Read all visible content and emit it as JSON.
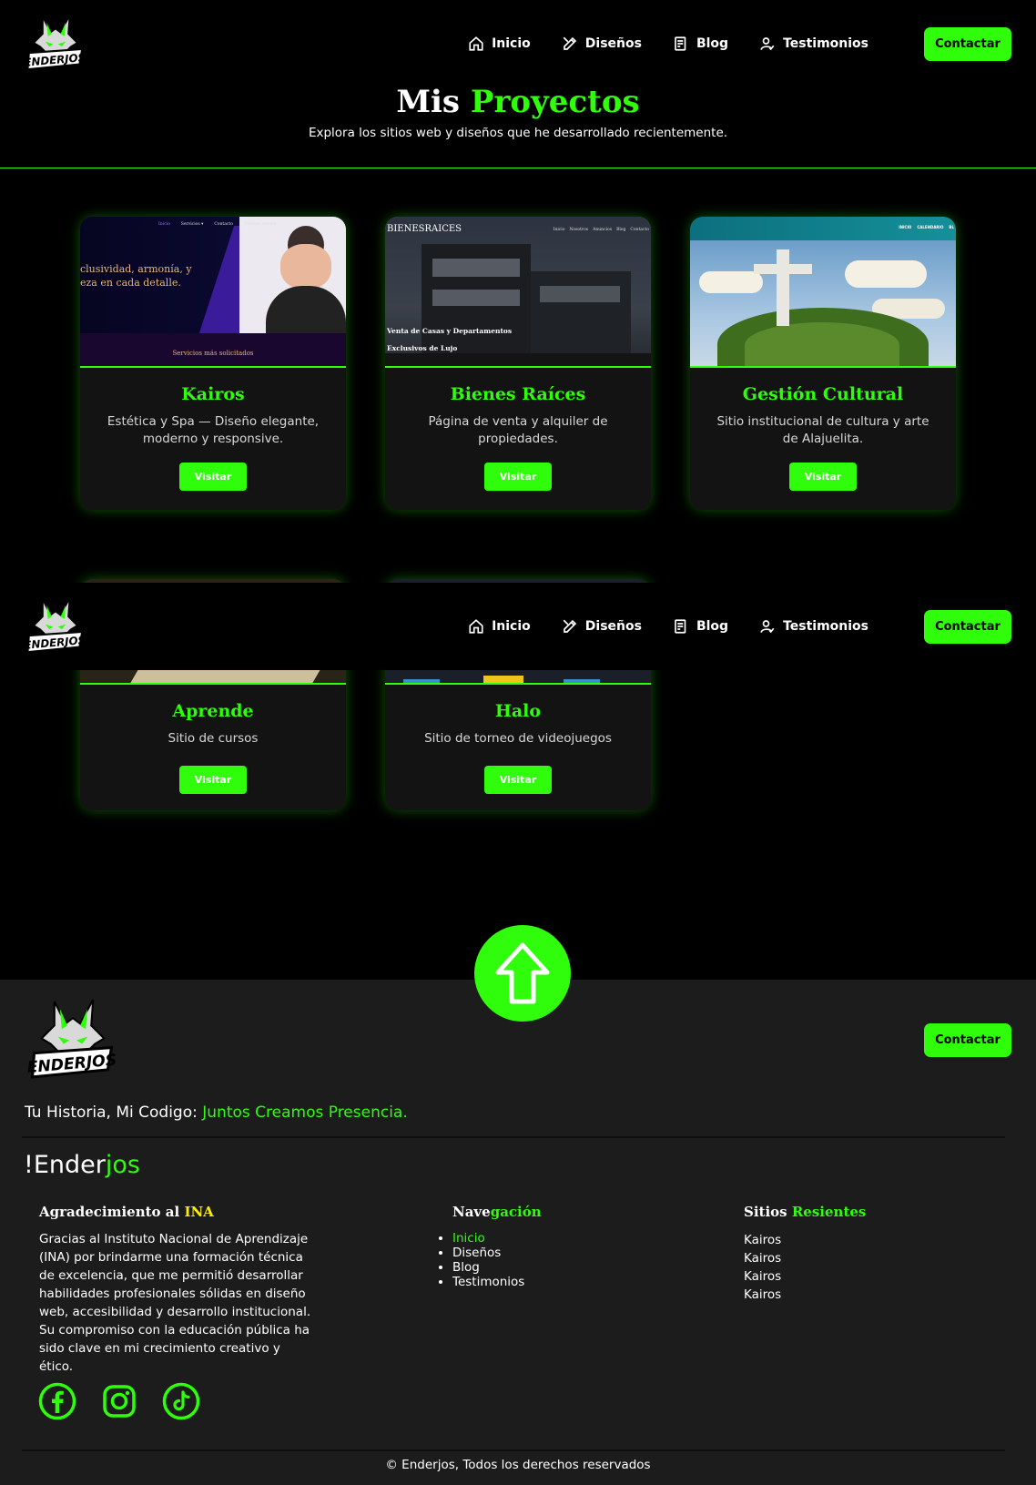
{
  "nav": {
    "logo_text": "ENDERJOS",
    "links": [
      {
        "label": "Inicio",
        "icon": "home-icon"
      },
      {
        "label": "Diseños",
        "icon": "pencil-icon"
      },
      {
        "label": "Blog",
        "icon": "article-icon"
      },
      {
        "label": "Testimonios",
        "icon": "user-check-icon"
      }
    ],
    "contact_label": "Contactar"
  },
  "hero": {
    "title_main": "Mis",
    "title_accent": "Proyectos",
    "subtitle": "Explora los sitios web y diseños que he desarrollado recientemente."
  },
  "projects": [
    {
      "title": "Kairos",
      "description": "Estética y Spa — Diseño elegante, moderno y responsive.",
      "button": "Visitar",
      "thumb_nav": [
        "Inicio",
        "Servicios ▾",
        "Contacto",
        "Quiénes Somos"
      ],
      "thumb_text_1": "clusividad, armonía, y",
      "thumb_text_2": "eza en cada detalle.",
      "thumb_footer": "Servicios más solicitados"
    },
    {
      "title": "Bienes Raíces",
      "description": "Página de venta y alquiler de propiedades.",
      "button": "Visitar",
      "thumb_logo": "BIENESRAICES",
      "thumb_nav": [
        "Inicio",
        "Nosotros",
        "Anuncios",
        "Blog",
        "Contacto"
      ],
      "thumb_text_1": "Venta de Casas y Departamentos",
      "thumb_text_2": "Exclusivos de Lujo"
    },
    {
      "title": "Gestión Cultural",
      "description": "Sitio institucional de cultura y arte de Alajuelita.",
      "button": "Visitar",
      "thumb_nav": [
        "INICIO",
        "CALENDARIO",
        "BL"
      ]
    },
    {
      "title": "Aprende",
      "description": "Sitio de cursos",
      "button": "Visitar"
    },
    {
      "title": "Halo",
      "description": "Sitio de torneo de videojuegos",
      "button": "Visitar"
    }
  ],
  "footer": {
    "logo_text": "ENDERJOS",
    "contact_label": "Contactar",
    "tagline_main": "Tu Historia, Mi Codigo:",
    "tagline_accent": "Juntos Creamos Presencia.",
    "brand_main": "!Ender",
    "brand_accent": "jos",
    "col1_title_main": "Agradecimiento al",
    "col1_title_accent": "INA",
    "col1_text": "Gracias al Instituto Nacional de Aprendizaje (INA) por brindarme una formación técnica de excelencia, que me permitió desarrollar habilidades profesionales sólidas en diseño web, accesibilidad y desarrollo institucional. Su compromiso con la educación pública ha sido clave en mi crecimiento creativo y ético.",
    "col2_title_main": "Nave",
    "col2_title_accent": "gación",
    "nav_items": [
      "Inicio",
      "Diseños",
      "Blog",
      "Testimonios"
    ],
    "col3_title_main": "Sitios",
    "col3_title_accent": "Resientes",
    "sites": [
      "Kairos",
      "Kairos",
      "Kairos",
      "Kairos"
    ],
    "socials": [
      "facebook-icon",
      "instagram-icon",
      "tiktok-icon"
    ],
    "copyright": "© Enderjos, Todos los derechos reservados"
  },
  "colors": {
    "accent": "#2ffd0b",
    "yellow": "#ffeb0a",
    "background": "#000000",
    "footer_bg": "#1c1c1c",
    "card_bg": "#131313"
  }
}
